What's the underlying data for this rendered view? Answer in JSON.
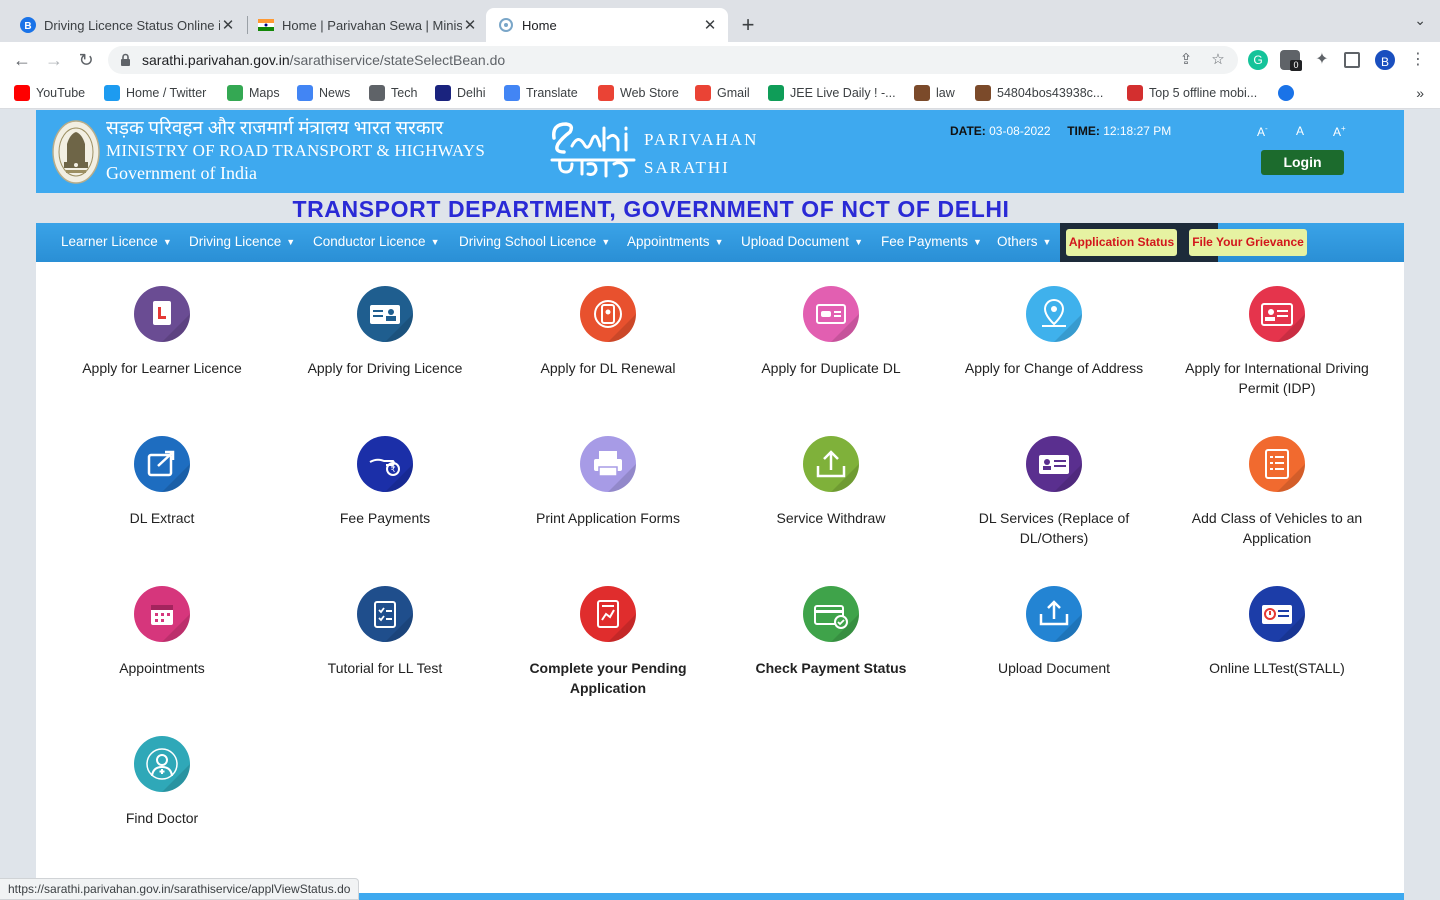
{
  "browser": {
    "tabs": [
      {
        "title": "Driving Licence Status Online i",
        "favicon": "blue-b-icon",
        "active": false
      },
      {
        "title": "Home | Parivahan Sewa | Minist",
        "favicon": "india-flag-icon",
        "active": false
      },
      {
        "title": "Home",
        "favicon": "sarathi-favicon",
        "active": true
      }
    ],
    "url_host": "sarathi.parivahan.gov.in",
    "url_path": "/sarathiservice/stateSelectBean.do",
    "extension_badge": "0",
    "bookmarks": [
      {
        "label": "YouTube",
        "icon": "youtube-icon",
        "color": "#ff0000"
      },
      {
        "label": "Home / Twitter",
        "icon": "twitter-icon",
        "color": "#1d9bf0"
      },
      {
        "label": "Maps",
        "icon": "maps-icon",
        "color": "#34a853"
      },
      {
        "label": "News",
        "icon": "google-news-icon",
        "color": "#4285f4"
      },
      {
        "label": "Tech",
        "icon": "folder-icon",
        "color": "#5f6368"
      },
      {
        "label": "Delhi",
        "icon": "delhi-icon",
        "color": "#1a237e"
      },
      {
        "label": "Translate",
        "icon": "translate-icon",
        "color": "#4285f4"
      },
      {
        "label": "Web Store",
        "icon": "web-store-icon",
        "color": "#ea4335"
      },
      {
        "label": "Gmail",
        "icon": "gmail-icon",
        "color": "#ea4335"
      },
      {
        "label": "JEE Live Daily ! -...",
        "icon": "sheets-icon",
        "color": "#0f9d58"
      },
      {
        "label": "law",
        "icon": "seal-icon",
        "color": "#7b4a2a"
      },
      {
        "label": "54804bos43938c...",
        "icon": "seal-icon",
        "color": "#7b4a2a"
      },
      {
        "label": "Top 5 offline mobi...",
        "icon": "stack-icon",
        "color": "#d32f2f"
      }
    ],
    "status_url": "https://sarathi.parivahan.gov.in/sarathiservice/applViewStatus.do"
  },
  "header": {
    "ministry_hindi": "सड़क परिवहन और राजमार्ग मंत्रालय भारत सरकार",
    "ministry_english": "MINISTRY OF ROAD TRANSPORT & HIGHWAYS",
    "government": "Government of India",
    "brand_line1": "PARIVAHAN",
    "brand_line2": "SARATHI",
    "date_label": "DATE:",
    "date_value": "03-08-2022",
    "time_label": "TIME:",
    "time_value": "12:18:27 PM",
    "font_decrease": "A-",
    "font_normal": "A",
    "font_increase": "A+",
    "login_label": "Login",
    "department_title": "TRANSPORT DEPARTMENT, GOVERNMENT OF NCT OF DELHI"
  },
  "nav": {
    "items": [
      "Learner Licence",
      "Driving Licence",
      "Conductor Licence",
      "Driving School Licence",
      "Appointments",
      "Upload Document",
      "Fee Payments",
      "Others"
    ],
    "application_status": "Application Status",
    "file_grievance": "File Your Grievance"
  },
  "services": [
    {
      "label": "Apply for Learner Licence",
      "icon": "learner-licence-icon",
      "color": "#6a4c93",
      "bold": false
    },
    {
      "label": "Apply for Driving Licence",
      "icon": "driving-licence-icon",
      "color": "#1f5e8f",
      "bold": false
    },
    {
      "label": "Apply for DL Renewal",
      "icon": "dl-renewal-icon",
      "color": "#e8512e",
      "bold": false
    },
    {
      "label": "Apply for Duplicate DL",
      "icon": "duplicate-dl-icon",
      "color": "#e25fb1",
      "bold": false
    },
    {
      "label": "Apply for Change of Address",
      "icon": "change-address-icon",
      "color": "#3fb1ec",
      "bold": false
    },
    {
      "label": "Apply for International Driving Permit (IDP)",
      "icon": "idp-icon",
      "color": "#e5344c",
      "bold": false
    },
    {
      "label": "DL Extract",
      "icon": "dl-extract-icon",
      "color": "#1e6dc0",
      "bold": false
    },
    {
      "label": "Fee Payments",
      "icon": "fee-payment-icon",
      "color": "#1b2fa8",
      "bold": false
    },
    {
      "label": "Print Application Forms",
      "icon": "printer-icon",
      "color": "#a79be6",
      "bold": false
    },
    {
      "label": "Service Withdraw",
      "icon": "withdraw-icon",
      "color": "#7fb13a",
      "bold": false
    },
    {
      "label": "DL Services (Replace of DL/Others)",
      "icon": "dl-services-icon",
      "color": "#5a2f8f",
      "bold": false
    },
    {
      "label": "Add Class of Vehicles to an Application",
      "icon": "add-class-icon",
      "color": "#f16a2f",
      "bold": false
    },
    {
      "label": "Appointments",
      "icon": "calendar-icon",
      "color": "#d6367c",
      "bold": false
    },
    {
      "label": "Tutorial for LL Test",
      "icon": "tutorial-icon",
      "color": "#1f4e8c",
      "bold": false
    },
    {
      "label": "Complete your Pending Application",
      "icon": "pending-application-icon",
      "color": "#e02d2d",
      "bold": true
    },
    {
      "label": "Check Payment Status",
      "icon": "payment-status-icon",
      "color": "#3fa34a",
      "bold": true
    },
    {
      "label": "Upload Document",
      "icon": "upload-icon",
      "color": "#2384d3",
      "bold": false
    },
    {
      "label": "Online LLTest(STALL)",
      "icon": "online-test-icon",
      "color": "#1c3da8",
      "bold": false
    },
    {
      "label": "Find Doctor",
      "icon": "doctor-icon",
      "color": "#2fa8b8",
      "bold": false
    }
  ]
}
